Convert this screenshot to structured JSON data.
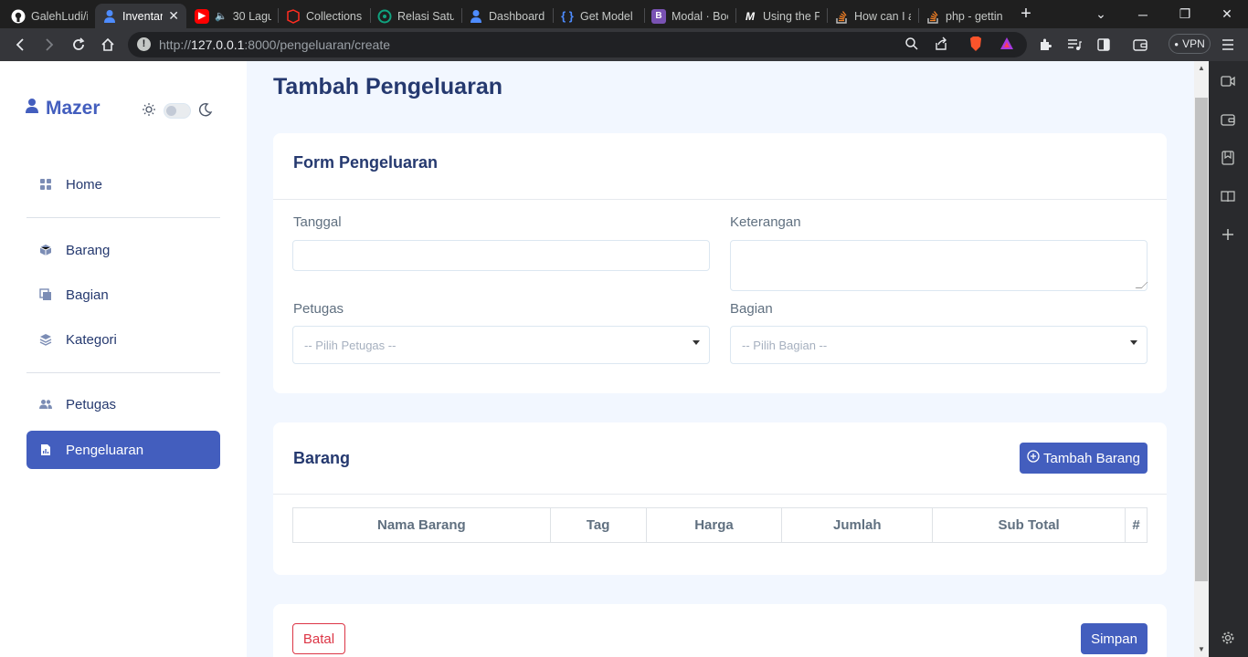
{
  "browser": {
    "tabs": [
      {
        "title": "GalehLudi/i",
        "icon": "github-icon",
        "color": "#ffffff"
      },
      {
        "title": "Inventar",
        "icon": "person-icon",
        "color": "#4e8cff",
        "active": true
      },
      {
        "title": "30 Lagu",
        "icon": "youtube-icon",
        "color": "#ff0000"
      },
      {
        "title": "Collections",
        "icon": "laravel-icon",
        "color": "#ff2d20"
      },
      {
        "title": "Relasi Satu-",
        "icon": "openai-icon",
        "color": "#10a37f"
      },
      {
        "title": "Dashboard",
        "icon": "person-icon",
        "color": "#4e8cff"
      },
      {
        "title": "Get Model",
        "icon": "braces-icon",
        "color": "#4e8cff"
      },
      {
        "title": "Modal · Boo",
        "icon": "bootstrap-icon",
        "color": "#7952b3"
      },
      {
        "title": "Using the F",
        "icon": "medium-icon",
        "color": "#ffffff"
      },
      {
        "title": "How can I a",
        "icon": "stackoverflow-icon",
        "color": "#f48024"
      },
      {
        "title": "php - gettin",
        "icon": "stackoverflow-icon",
        "color": "#f48024"
      }
    ],
    "url_host": "127.0.0.1",
    "url_prefix": "http://",
    "url_rest": ":8000/pengeluaran/create",
    "vpn_label": "VPN"
  },
  "sidebar": {
    "brand": "Mazer",
    "items": [
      {
        "label": "Home",
        "icon": "grid-icon"
      },
      {
        "label": "Barang",
        "icon": "box-icon"
      },
      {
        "label": "Bagian",
        "icon": "layers-square-icon"
      },
      {
        "label": "Kategori",
        "icon": "stack-icon"
      },
      {
        "label": "Petugas",
        "icon": "people-icon"
      },
      {
        "label": "Pengeluaran",
        "icon": "report-icon",
        "active": true
      }
    ]
  },
  "page": {
    "title": "Tambah Pengeluaran"
  },
  "form": {
    "card_title": "Form Pengeluaran",
    "tanggal_label": "Tanggal",
    "tanggal_value": "",
    "keterangan_label": "Keterangan",
    "keterangan_value": "",
    "petugas_label": "Petugas",
    "petugas_placeholder": "-- Pilih Petugas --",
    "bagian_label": "Bagian",
    "bagian_placeholder": "-- Pilih Bagian --"
  },
  "barang": {
    "card_title": "Barang",
    "add_button": "Tambah Barang",
    "columns": [
      "Nama Barang",
      "Tag",
      "Harga",
      "Jumlah",
      "Sub Total",
      "#"
    ]
  },
  "actions": {
    "cancel": "Batal",
    "save": "Simpan"
  }
}
